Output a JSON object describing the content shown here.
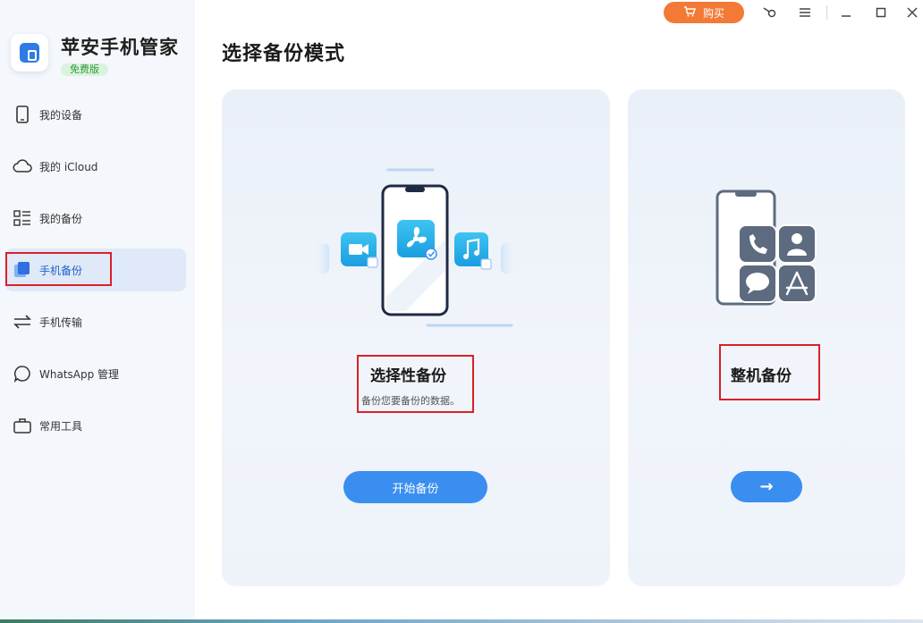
{
  "app": {
    "name": "苹安手机管家",
    "edition": "免费版"
  },
  "titlebar": {
    "buy_label": "购买",
    "icons": [
      "cart-icon",
      "key-icon",
      "menu-icon",
      "minimize-icon",
      "maximize-icon",
      "close-icon"
    ]
  },
  "sidebar": {
    "items": [
      {
        "label": "我的设备",
        "icon": "phone-icon"
      },
      {
        "label": "我的 iCloud",
        "icon": "cloud-icon"
      },
      {
        "label": "我的备份",
        "icon": "list-icon"
      },
      {
        "label": "手机备份",
        "icon": "backup-icon",
        "active": true
      },
      {
        "label": "手机传输",
        "icon": "transfer-icon"
      },
      {
        "label": "WhatsApp 管理",
        "icon": "chat-bubble-icon"
      },
      {
        "label": "常用工具",
        "icon": "toolbox-icon"
      }
    ]
  },
  "main": {
    "title": "选择备份模式",
    "selective": {
      "title": "选择性备份",
      "desc": "备份您要备份的数据。",
      "button": "开始备份"
    },
    "full": {
      "title": "整机备份",
      "button": "→"
    }
  },
  "colors": {
    "accent": "#3a8ef0",
    "buy": "#f27a36",
    "highlight_frame": "#d9202a",
    "edition_green": "#2e9a3c"
  }
}
